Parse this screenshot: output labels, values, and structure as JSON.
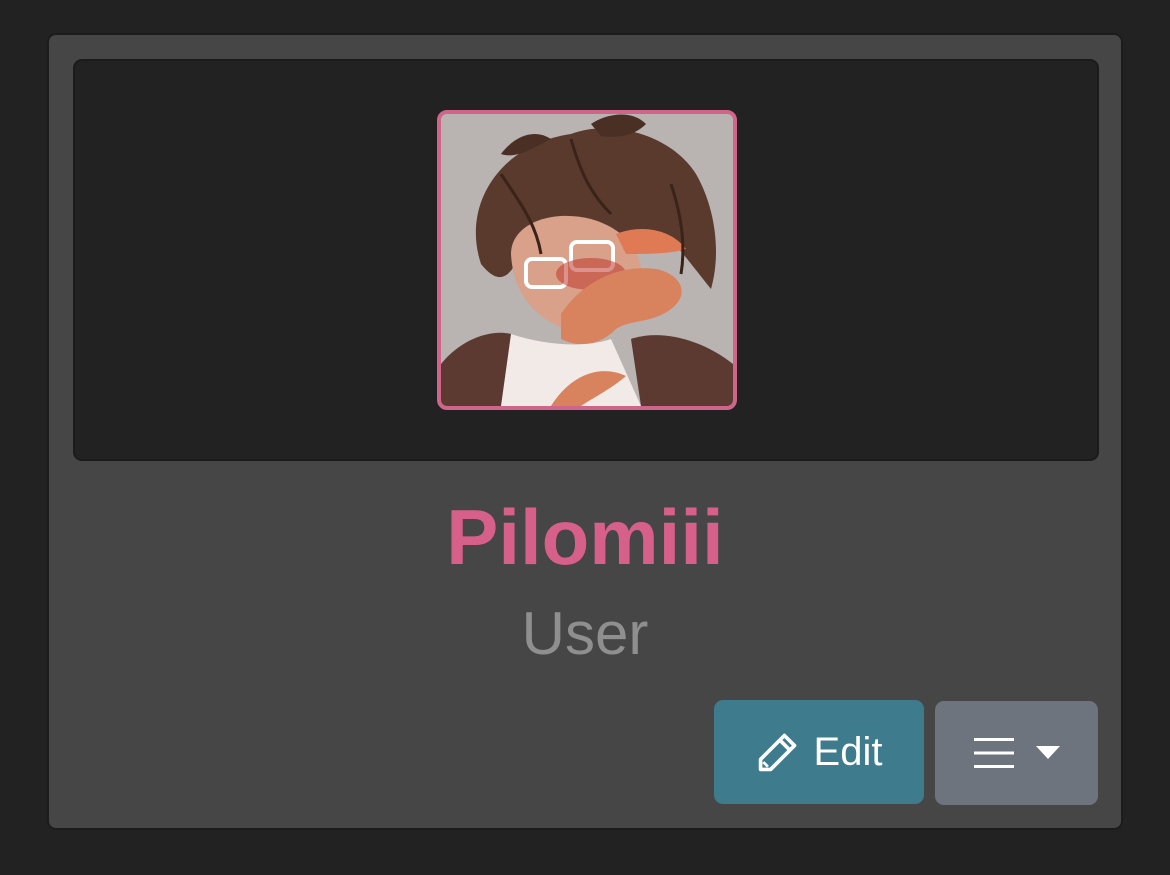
{
  "profile": {
    "username": "Pilomiii",
    "role": "User",
    "avatar_icon": "user-avatar-illustration",
    "accent_color": "#d6608a"
  },
  "actions": {
    "edit_label": "Edit",
    "edit_icon": "pencil-icon",
    "menu_icon": "hamburger-menu-icon",
    "dropdown_icon": "caret-down-icon",
    "edit_color": "#3d7b8d",
    "menu_color": "#6d747e"
  }
}
